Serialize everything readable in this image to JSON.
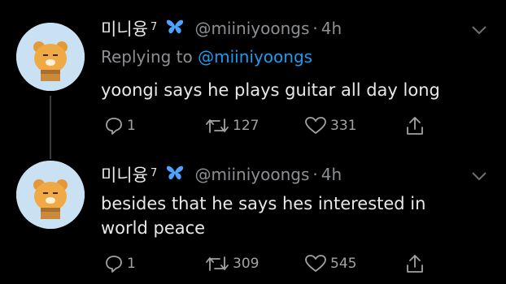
{
  "colors": {
    "background": "#000000",
    "text": "#e8e8e8",
    "muted": "#8d8f92",
    "link": "#1d9bf0",
    "avatar_bg": "#c9e1f3"
  },
  "tweets": [
    {
      "display_name": "미니융",
      "name_sup": "7",
      "badge_icon": "butterfly-icon",
      "handle": "@miiniyoongs",
      "separator": "·",
      "time": "4h",
      "reply_prefix": "Replying to ",
      "reply_to": "@miiniyoongs",
      "text": "yoongi says he plays guitar all day long",
      "replies": "1",
      "retweets": "127",
      "likes": "331"
    },
    {
      "display_name": "미니융",
      "name_sup": "7",
      "badge_icon": "butterfly-icon",
      "handle": "@miiniyoongs",
      "separator": "·",
      "time": "4h",
      "text": "besides that he says hes interested in\nworld peace",
      "replies": "1",
      "retweets": "309",
      "likes": "545"
    }
  ]
}
